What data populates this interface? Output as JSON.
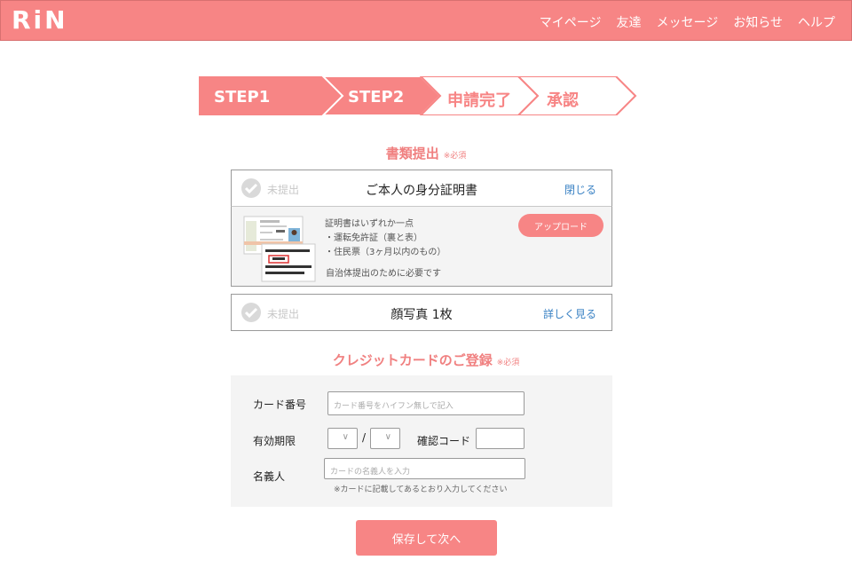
{
  "header": {
    "logo": "RiN",
    "nav": [
      "マイページ",
      "友達",
      "メッセージ",
      "お知らせ",
      "ヘルプ"
    ]
  },
  "steps": [
    {
      "label": "STEP1",
      "state": "done"
    },
    {
      "label": "STEP2",
      "state": "current"
    },
    {
      "label": "申請完了",
      "state": "upcoming"
    },
    {
      "label": "承認",
      "state": "upcoming"
    }
  ],
  "documents": {
    "title": "書類提出",
    "required": "※必須",
    "items": [
      {
        "status": "未提出",
        "title": "ご本人の身分証明書",
        "link": "閉じる",
        "detail": {
          "line1": "証明書はいずれか一点",
          "line2": "・運転免許証（裏と表）",
          "line3": "・住民票（3ヶ月以内のもの）",
          "note": "自治体提出のために必要です",
          "upload": "アップロード"
        }
      },
      {
        "status": "未提出",
        "title": "顔写真 1枚",
        "link": "詳しく見る"
      }
    ]
  },
  "credit": {
    "title": "クレジットカードのご登録",
    "required": "※必須",
    "card_number_label": "カード番号",
    "card_number_placeholder": "カード番号をハイフン無しで記入",
    "expiry_label": "有効期限",
    "expiry_sep": "/",
    "cvc_label": "確認コード",
    "holder_label": "名義人",
    "holder_placeholder": "カードの名義人を入力",
    "hint": "※カードに記載してあるとおり入力してください"
  },
  "save_button": "保存して次へ",
  "colors": {
    "accent": "#f78585",
    "link": "#3a82c4",
    "panel": "#f4f4f4"
  }
}
